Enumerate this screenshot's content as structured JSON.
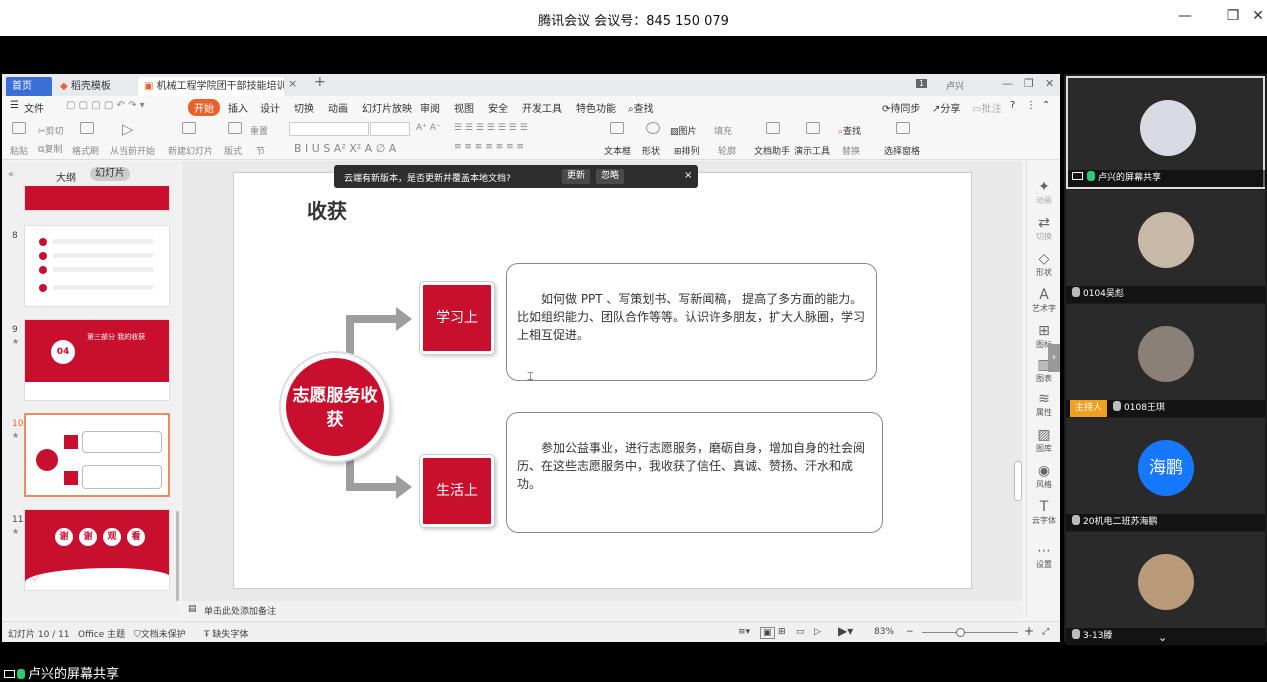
{
  "meeting": {
    "title": "腾讯会议 会议号：845 150 079",
    "share_caption": "卢兴的屏幕共享"
  },
  "wps": {
    "tabs": {
      "home": "首页",
      "template": "稻壳模板",
      "file": "机械工程学院团干部技能培训.pptx"
    },
    "user": "卢兴",
    "menu": [
      "文件",
      "开始",
      "插入",
      "设计",
      "切换",
      "动画",
      "幻灯片放映",
      "审阅",
      "视图",
      "安全",
      "开发工具",
      "特色功能",
      "查找"
    ],
    "menu_right": [
      "待同步",
      "分享",
      "批注"
    ],
    "ribbon": {
      "paste": "粘贴",
      "cut": "剪切",
      "copy": "复制",
      "format_painter": "格式刷",
      "play_from_current": "从当前开始",
      "new_slide": "新建幻灯片",
      "layout": "版式",
      "reset": "重置",
      "section": "节",
      "textbox": "文本框",
      "shape": "形状",
      "picture": "图片",
      "fill": "填充",
      "arrange": "排列",
      "outline": "轮廓",
      "find": "查找",
      "replace": "替换",
      "doc_assistant": "文档助手",
      "presentation_tools": "演示工具",
      "select_pane": "选择窗格"
    },
    "pane": {
      "outline_tab": "大纲",
      "slides_tab": "幻灯片",
      "slide_numbers": [
        "8",
        "9",
        "10",
        "11"
      ],
      "thumb9_title": "第三部分 我的收获",
      "thumb9_num": "04",
      "thumb11_text": [
        "谢",
        "谢",
        "观",
        "看"
      ]
    },
    "notice": {
      "text": "云端有新版本，是否更新并覆盖本地文档?",
      "update": "更新",
      "ignore": "忽略"
    },
    "slide": {
      "title": "收获",
      "hub": "志愿服务收获",
      "study_label": "学习上",
      "life_label": "生活上",
      "study_text": "如何做 PPT 、写策划书、写新闻稿， 提高了多方面的能力。比如组织能力、团队合作等等。认识许多朋友，扩大人脉圈，学习上相互促进。",
      "life_text": "参加公益事业，进行志愿服务，磨砺自身，增加自身的社会阅历、在这些志愿服务中，我收获了信任、真诚、赞扬、汗水和成功。"
    },
    "notes_placeholder": "单击此处添加备注",
    "right_pane": [
      "动画",
      "切换",
      "形状",
      "艺术字",
      "图标",
      "图表",
      "属性",
      "图库",
      "风格",
      "云字体",
      "设置"
    ],
    "status": {
      "slide_pos": "幻灯片 10 / 11",
      "theme": "Office 主题",
      "protect": "文档未保护",
      "missing_font": "缺失字体",
      "zoom": "83%"
    }
  },
  "participants": [
    {
      "name": "卢兴的屏幕共享",
      "type": "share"
    },
    {
      "name": "0104吴彪",
      "type": "normal"
    },
    {
      "name": "0108王琪",
      "type": "host",
      "badge": "主持人"
    },
    {
      "name": "20机电二班苏海鹏",
      "type": "normal",
      "avatar_text": "海鹏"
    },
    {
      "name": "3-13滕",
      "type": "normal"
    }
  ],
  "colors": {
    "accent_red": "#c8102e",
    "wps_orange": "#e8632b",
    "tencent_blue": "#1678ff"
  }
}
